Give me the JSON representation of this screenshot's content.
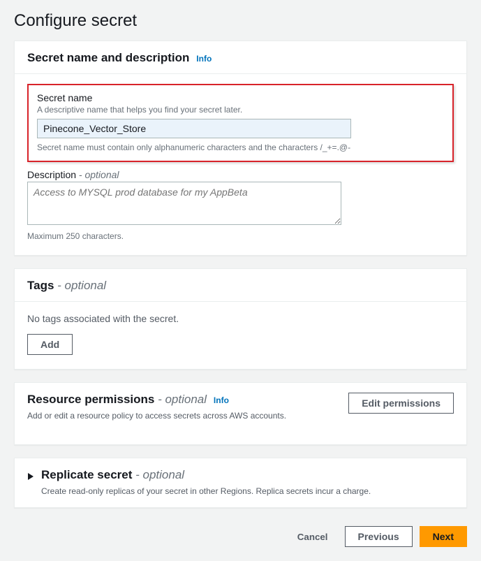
{
  "page": {
    "title": "Configure secret"
  },
  "nameDesc": {
    "header": "Secret name and description",
    "info": "Info",
    "name_label": "Secret name",
    "name_hint": "A descriptive name that helps you find your secret later.",
    "name_value": "Pinecone_Vector_Store",
    "name_constraint": "Secret name must contain only alphanumeric characters and the characters /_+=.@-",
    "desc_label": "Description",
    "desc_optional": " - optional",
    "desc_placeholder": "Access to MYSQL prod database for my AppBeta",
    "desc_constraint": "Maximum 250 characters."
  },
  "tags": {
    "header": "Tags",
    "optional": " - optional",
    "empty": "No tags associated with the secret.",
    "add_label": "Add"
  },
  "permissions": {
    "header": "Resource permissions",
    "optional": " - optional",
    "info": "Info",
    "subtext": "Add or edit a resource policy to access secrets across AWS accounts.",
    "edit_label": "Edit permissions"
  },
  "replicate": {
    "header": "Replicate secret",
    "optional": " - optional",
    "subtext": "Create read-only replicas of your secret in other Regions. Replica secrets incur a charge."
  },
  "footer": {
    "cancel": "Cancel",
    "previous": "Previous",
    "next": "Next"
  }
}
